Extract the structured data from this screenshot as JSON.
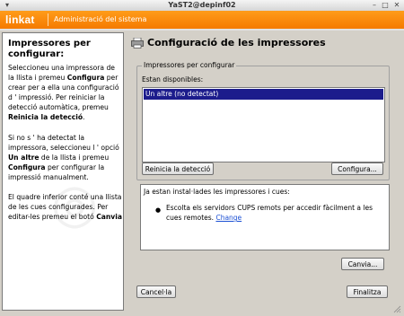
{
  "window": {
    "title": "YaST2@depinf02"
  },
  "banner": {
    "logo": "linkat",
    "subtitle": "Administració del sistema"
  },
  "help": {
    "heading_1": "Impressores per",
    "heading_2": "configurar:",
    "p1_a": "Seleccioneu una impressora de la llista i premeu ",
    "p1_b": "Configura",
    "p1_c": " per crear per a ella una configuració d ' impressió. Per reiniciar la detecció automàtica, premeu ",
    "p1_d": "Reinicia la detecció",
    "p1_e": ".",
    "p2_a": "Si no s ' ha detectat la impressora, seleccioneu l ' opció ",
    "p2_b": "Un altre",
    "p2_c": " de la llista i premeu ",
    "p2_d": "Configura",
    "p2_e": " per configurar la impressió manualment.",
    "p3_a": "El quadre inferior conté una llista de les cues configurades. Per editar-les premeu el botó ",
    "p3_b": "Canvia"
  },
  "main": {
    "title": "Configuració de les impressores",
    "group_label": "Impressores per configurar",
    "available_label": "Estan disponibles:",
    "printers": [
      {
        "label": "Un altre (no detectat)",
        "selected": true
      }
    ],
    "restart_button": "Reinicia la detecció",
    "configure_button": "Configura...",
    "installed_text": "Ja estan instal·lades les impressores i cues:",
    "cups_text": "Escolta els servidors CUPS remots per accedir fàcilment a les cues remotes.",
    "change_link": "Change",
    "edit_button": "Canvia...",
    "cancel_button": "Cancel·la",
    "finish_button": "Finalitza"
  }
}
